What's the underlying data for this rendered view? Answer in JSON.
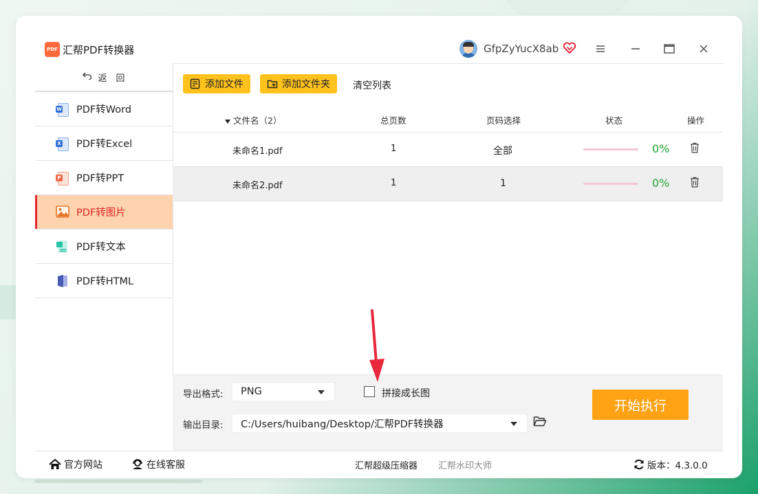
{
  "window": {
    "app_logo_text": "PDF",
    "app_title": "汇帮PDF转换器",
    "username": "GfpZyYucX8ab",
    "controls": [
      "menu",
      "minimize",
      "maximize",
      "close"
    ]
  },
  "sidebar": {
    "back_label": "返　回",
    "items": [
      {
        "label": "PDF转Word",
        "icon": "word-icon",
        "color": "#2f6fd6",
        "tag": "W",
        "active": false
      },
      {
        "label": "PDF转Excel",
        "icon": "excel-icon",
        "color": "#2f6fd6",
        "tag": "X",
        "active": false
      },
      {
        "label": "PDF转PPT",
        "icon": "ppt-icon",
        "color": "#f06a4a",
        "tag": "P",
        "active": false
      },
      {
        "label": "PDF转图片",
        "icon": "image-icon",
        "color": "#f0883a",
        "tag": "",
        "active": true
      },
      {
        "label": "PDF转文本",
        "icon": "text-icon",
        "color": "#27c4a6",
        "tag": "",
        "active": false
      },
      {
        "label": "PDF转HTML",
        "icon": "html-icon",
        "color": "#4a5bb5",
        "tag": "",
        "active": false
      }
    ]
  },
  "toolbar": {
    "add_file": "添加文件",
    "add_folder": "添加文件夹",
    "clear_list": "清空列表"
  },
  "table": {
    "headers": {
      "filename": "文件名（2）",
      "pages": "总页数",
      "page_select": "页码选择",
      "status": "状态",
      "action": "操作"
    },
    "rows": [
      {
        "filename": "未命名1.pdf",
        "pages": "1",
        "page_select": "全部",
        "progress": 0,
        "percent": "0%"
      },
      {
        "filename": "未命名2.pdf",
        "pages": "1",
        "page_select": "1",
        "progress": 0,
        "percent": "0%"
      }
    ]
  },
  "bottom": {
    "format_label": "导出格式:",
    "format_value": "PNG",
    "merge_label": "拼接成长图",
    "merge_checked": false,
    "output_label": "输出目录:",
    "output_value": "C:/Users/huibang/Desktop/汇帮PDF转换器",
    "start_button": "开始执行"
  },
  "footer": {
    "website": "官方网站",
    "support": "在线客服",
    "compressor": "汇帮超级压缩器",
    "watermark": "汇帮水印大师",
    "version": "版本：4.3.0.0"
  },
  "colors": {
    "accent_yellow": "#ffc21d",
    "start_orange": "#ffa214",
    "active_bg": "#ffd3ae",
    "active_text": "#e0252a",
    "percent_green": "#22a633",
    "annotation_red": "#e8283c"
  }
}
